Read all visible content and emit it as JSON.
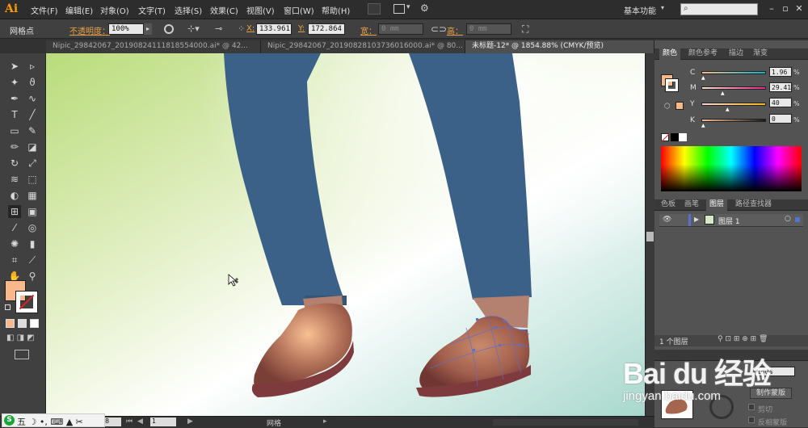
{
  "app": {
    "logo": "Ai",
    "workspace": "基本功能"
  },
  "menu": [
    "文件(F)",
    "编辑(E)",
    "对象(O)",
    "文字(T)",
    "选择(S)",
    "效果(C)",
    "视图(V)",
    "窗口(W)",
    "帮助(H)"
  ],
  "control": {
    "selection_label": "网格点",
    "opacity_label": "不透明度：",
    "opacity_value": "100%",
    "x_label": "X:",
    "x_value": "133.961",
    "y_label": "Y:",
    "y_value": "172.864",
    "w_label": "宽：",
    "w_value": "0 mm",
    "h_label": "高：",
    "h_value": "0 mm"
  },
  "tabs": [
    {
      "label": "Nipic_29842067_20190824111818554000.ai* @ 42...",
      "active": false
    },
    {
      "label": "Nipic_29842067_20190828103736016000.ai* @ 80...",
      "active": false
    },
    {
      "label": "未标题-12* @ 1854.88% (CMYK/预览)",
      "active": true
    }
  ],
  "panels": {
    "color_tabs": [
      "颜色",
      "颜色参考",
      "描边",
      "渐变"
    ],
    "cmyk": [
      {
        "label": "C",
        "value": "1.96"
      },
      {
        "label": "M",
        "value": "29.41"
      },
      {
        "label": "Y",
        "value": "40"
      },
      {
        "label": "K",
        "value": "0"
      }
    ],
    "layer_tabs": [
      "色板",
      "画笔",
      "图层",
      "路径查找器"
    ],
    "layer_name": "图层 1",
    "layer_count": "1 个图层",
    "transparency_opacity": "100%",
    "make_mask": "制作蒙版",
    "clip_label": "剪切",
    "invert_label": "反相蒙版"
  },
  "status": {
    "zoom": "8",
    "page": "1",
    "tool_name": "网格"
  },
  "colors": {
    "fill": "#f7b98b",
    "leg": "#3b6188",
    "shoe": "#9b5a49"
  },
  "watermark": {
    "brand": "Bai du 经验",
    "url": "jingyan.baidu.com"
  }
}
